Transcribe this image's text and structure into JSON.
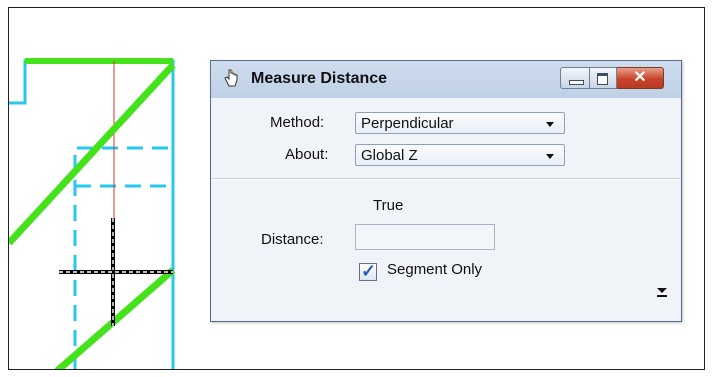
{
  "dialog": {
    "title": "Measure Distance",
    "method": {
      "label": "Method:",
      "value": "Perpendicular"
    },
    "about": {
      "label": "About:",
      "value": "Global Z"
    },
    "true_label": "True",
    "distance": {
      "label": "Distance:",
      "value": ""
    },
    "segment_only": {
      "label": "Segment Only",
      "checked": true
    }
  },
  "icons": {
    "title": "hand-pointer-icon",
    "minimize": "minimize-icon",
    "maximize": "maximize-icon",
    "close": "close-icon",
    "expand": "expand-arrow-icon"
  },
  "colors": {
    "canvas_green": "#44e21b",
    "canvas_cyan": "#25c8ee",
    "canvas_red": "#e53030",
    "close_red": "#c7442a"
  }
}
